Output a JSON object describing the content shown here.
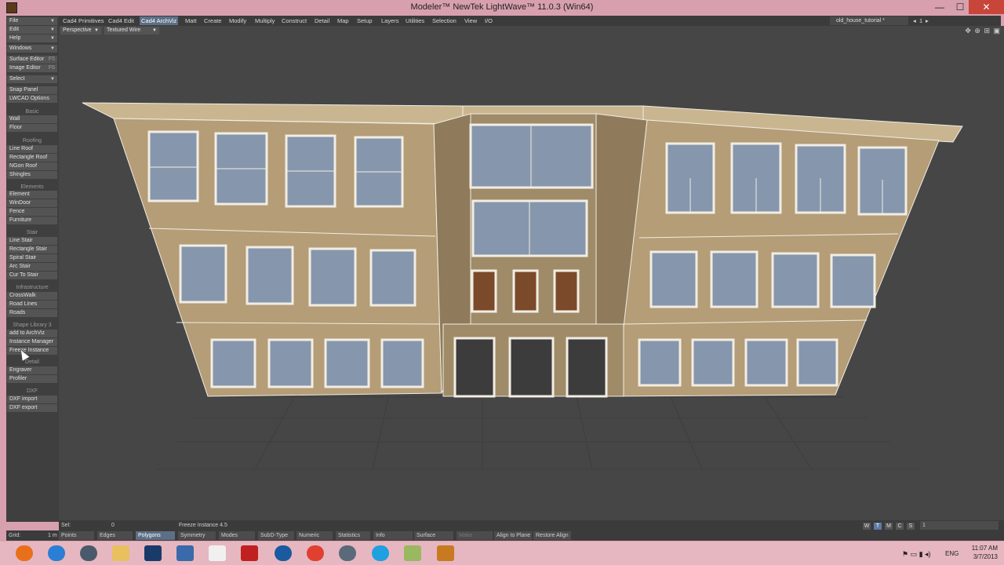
{
  "window": {
    "title": "Modeler™ NewTek LightWave™ 11.0.3 (Win64)",
    "minimize": "—",
    "maximize": "☐",
    "close": "✕"
  },
  "menu_tabs": [
    {
      "label": "Cad4 Primitives"
    },
    {
      "label": "Cad4 Edit"
    },
    {
      "label": "Cad4 ArchViz"
    },
    {
      "label": "Matt"
    },
    {
      "label": "Create"
    },
    {
      "label": "Modify"
    },
    {
      "label": "Multiply"
    },
    {
      "label": "Construct"
    },
    {
      "label": "Detail"
    },
    {
      "label": "Map"
    },
    {
      "label": "Setup"
    },
    {
      "label": "Layers"
    },
    {
      "label": "Utilities"
    },
    {
      "label": "Selection"
    },
    {
      "label": "View"
    },
    {
      "label": "I/O"
    }
  ],
  "scene_name": "old_house_tutorial *",
  "layer_number": "1",
  "left_panel": {
    "top_menus": [
      "File",
      "Edit",
      "Help",
      "Windows"
    ],
    "surface_editor": "Surface Editor",
    "surface_editor_key": "F5",
    "image_editor": "Image Editor",
    "image_editor_key": "F6",
    "select": "Select",
    "snap_panel": "Snap Panel",
    "lwcad_options": "LWCAD Options",
    "sections": [
      {
        "header": "Basic",
        "items": [
          "Wall",
          "Floor"
        ]
      },
      {
        "header": "Roofing",
        "items": [
          "Line Roof",
          "Rectangle Roof",
          "NGon Roof",
          "Shingles"
        ]
      },
      {
        "header": "Elements",
        "items": [
          "Element",
          "WinDoor",
          "Fence",
          "Furniture"
        ]
      },
      {
        "header": "Stair",
        "items": [
          "Line Stair",
          "Rectangle Stair",
          "Spiral Stair",
          "Arc Stair",
          "Cur To Stair"
        ]
      },
      {
        "header": "Infrastructure",
        "items": [
          "CrossWalk",
          "Road Lines",
          "Roads"
        ]
      },
      {
        "header": "Shape Library 3",
        "items": [
          "add to ArchViz",
          "Instance Manager",
          "Freeze Instance"
        ]
      },
      {
        "header": "Detail",
        "items": [
          "Engraver",
          "Profiler"
        ]
      },
      {
        "header": "DXF",
        "items": [
          "DXF import",
          "DXF export"
        ]
      }
    ]
  },
  "viewport": {
    "view_mode": "Perspective",
    "render_mode": "Textured Wire",
    "icons": "✥ ⊕ ⊞ ▣"
  },
  "status": {
    "sel_label": "Sel:",
    "sel_value": "0",
    "message": "Freeze Instance 4.5",
    "view_buttons": [
      "W",
      "T",
      "M",
      "C",
      "S"
    ],
    "active_view_button": "T",
    "layer_value": "1"
  },
  "bottom_bar": {
    "grid_label": "Grid:",
    "grid_value": "1 m",
    "points": "Points",
    "edges": "Edges",
    "polygons": "Polygons",
    "symmetry": "Symmetry",
    "modes": "Modes",
    "subd_type": "SubD-Type",
    "numeric": "Numeric",
    "statistics": "Statistics",
    "info": "Info",
    "surface": "Surface",
    "make": "Make",
    "align_to_plane": "Align to Plane",
    "restore_align": "Restore Align"
  },
  "taskbar": {
    "time": "11:07 AM",
    "date": "3/7/2013",
    "lang": "ENG",
    "apps": [
      {
        "name": "firefox-icon",
        "color": "#e8701a"
      },
      {
        "name": "ie-icon",
        "color": "#2a7fd4"
      },
      {
        "name": "lightwave-icon",
        "color": "#4a5a6a"
      },
      {
        "name": "explorer-icon",
        "color": "#e8c060"
      },
      {
        "name": "photoshop-icon",
        "color": "#1a3a6a"
      },
      {
        "name": "save-app-icon",
        "color": "#3a6aaa"
      },
      {
        "name": "document-icon",
        "color": "#f0f0f0"
      },
      {
        "name": "flash-icon",
        "color": "#c02020"
      },
      {
        "name": "teamviewer-icon",
        "color": "#1a5aa0"
      },
      {
        "name": "chrome-icon",
        "color": "#e04030"
      },
      {
        "name": "modeler-icon",
        "color": "#5a6a7a"
      },
      {
        "name": "skype-icon",
        "color": "#20a0e0"
      },
      {
        "name": "notes-icon",
        "color": "#9ab860"
      },
      {
        "name": "layout-icon",
        "color": "#c87a20"
      }
    ]
  },
  "colors": {
    "facade": "#b49d77",
    "trim": "#f2ede3",
    "glass": "#8696ad",
    "active_tab": "#5d6f87"
  }
}
